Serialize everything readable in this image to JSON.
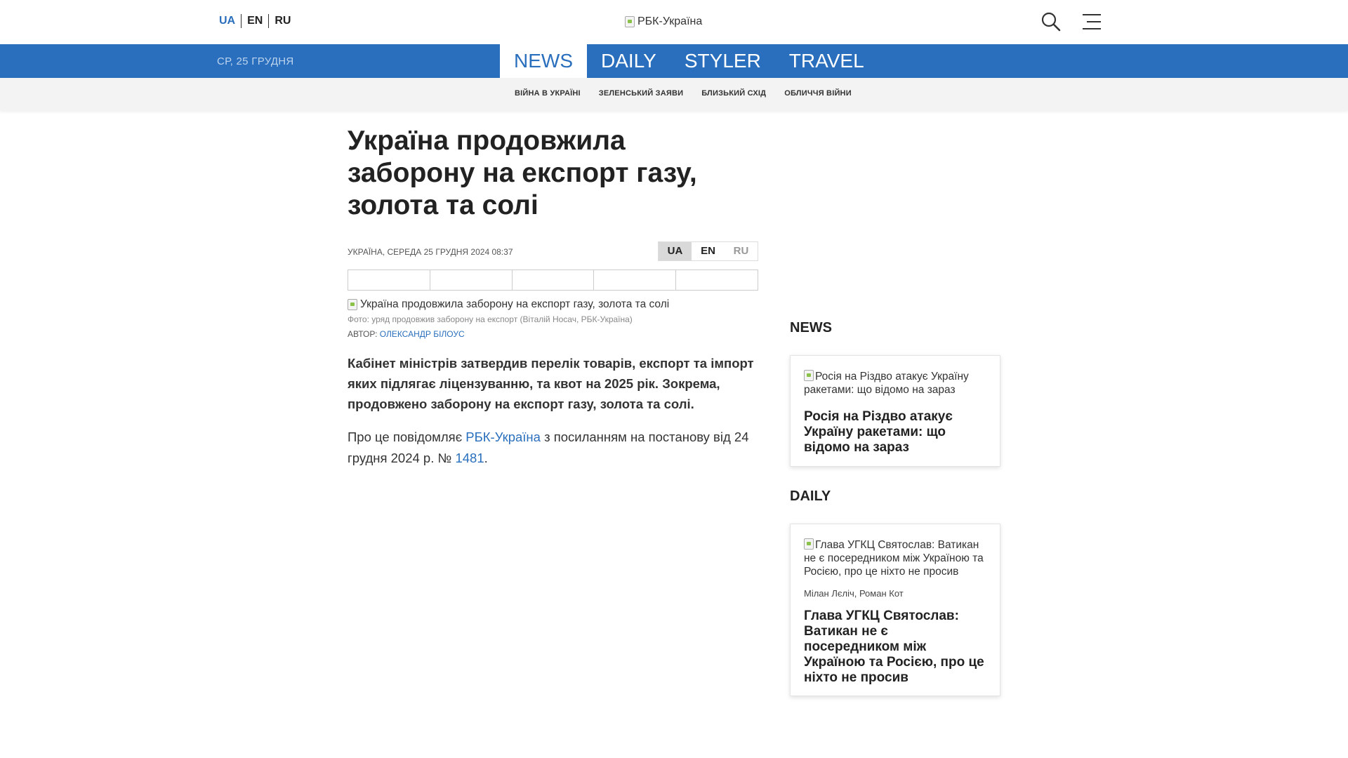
{
  "header": {
    "languages": [
      "UA",
      "EN",
      "RU"
    ],
    "active_language": "UA",
    "logo_alt": "РБК-Україна",
    "search_icon": "search-icon",
    "menu_icon": "hamburger-menu-icon"
  },
  "nav": {
    "date": "СР, 25 ГРУДНЯ",
    "sections": [
      "NEWS",
      "DAILY",
      "STYLER",
      "TRAVEL"
    ],
    "active_section": "NEWS"
  },
  "subnav": {
    "items": [
      "ВІЙНА В УКРАЇНІ",
      "ЗЕЛЕНСЬКИЙ ЗАЯВИ",
      "БЛИЗЬКИЙ СХІД",
      "ОБЛИЧЧЯ ВІЙНИ"
    ]
  },
  "article": {
    "title": "Україна продовжила заборону на експорт газу, золота та солі",
    "meta": "УКРАЇНА, СЕРЕДА 25 ГРУДНЯ 2024 08:37",
    "languages": [
      "UA",
      "EN",
      "RU"
    ],
    "image_alt": "Україна продовжила заборону на експорт газу, золота та солі",
    "caption": "Фото: уряд продовжив заборону на експорт (Віталій Носач, РБК-Україна)",
    "author_label": "АВТОР:",
    "author_name": "ОЛЕКСАНДР БІЛОУС",
    "lead": "Кабінет міністрів затвердив перелік товарів, експорт та імпорт яких підлягає ліцензуванню, та квот на 2025 рік. Зокрема, продовжено заборону на експорт газу, золота та солі.",
    "body_prefix": "Про це повідомляє ",
    "body_link1": "РБК-Україна",
    "body_middle": " з посиланням на постанову від 24 грудня 2024 р. № ",
    "body_link2": "1481",
    "body_suffix": "."
  },
  "sidebar": {
    "news_heading": "NEWS",
    "news_card": {
      "image_alt": "Росія на Різдво атакує Україну ракетами: що відомо на зараз",
      "title": "Росія на Різдво атакує Україну ракетами: що відомо на зараз"
    },
    "daily_heading": "DAILY",
    "daily_card": {
      "image_alt": "Глава УГКЦ Святослав: Ватикан не є посередником між Україною та Росією, про це ніхто не просив",
      "authors": "Мілан Лєліч, Роман Кот",
      "title": "Глава УГКЦ Святослав: Ватикан не є посередником між Україною та Росією, про це ніхто не просив"
    }
  }
}
